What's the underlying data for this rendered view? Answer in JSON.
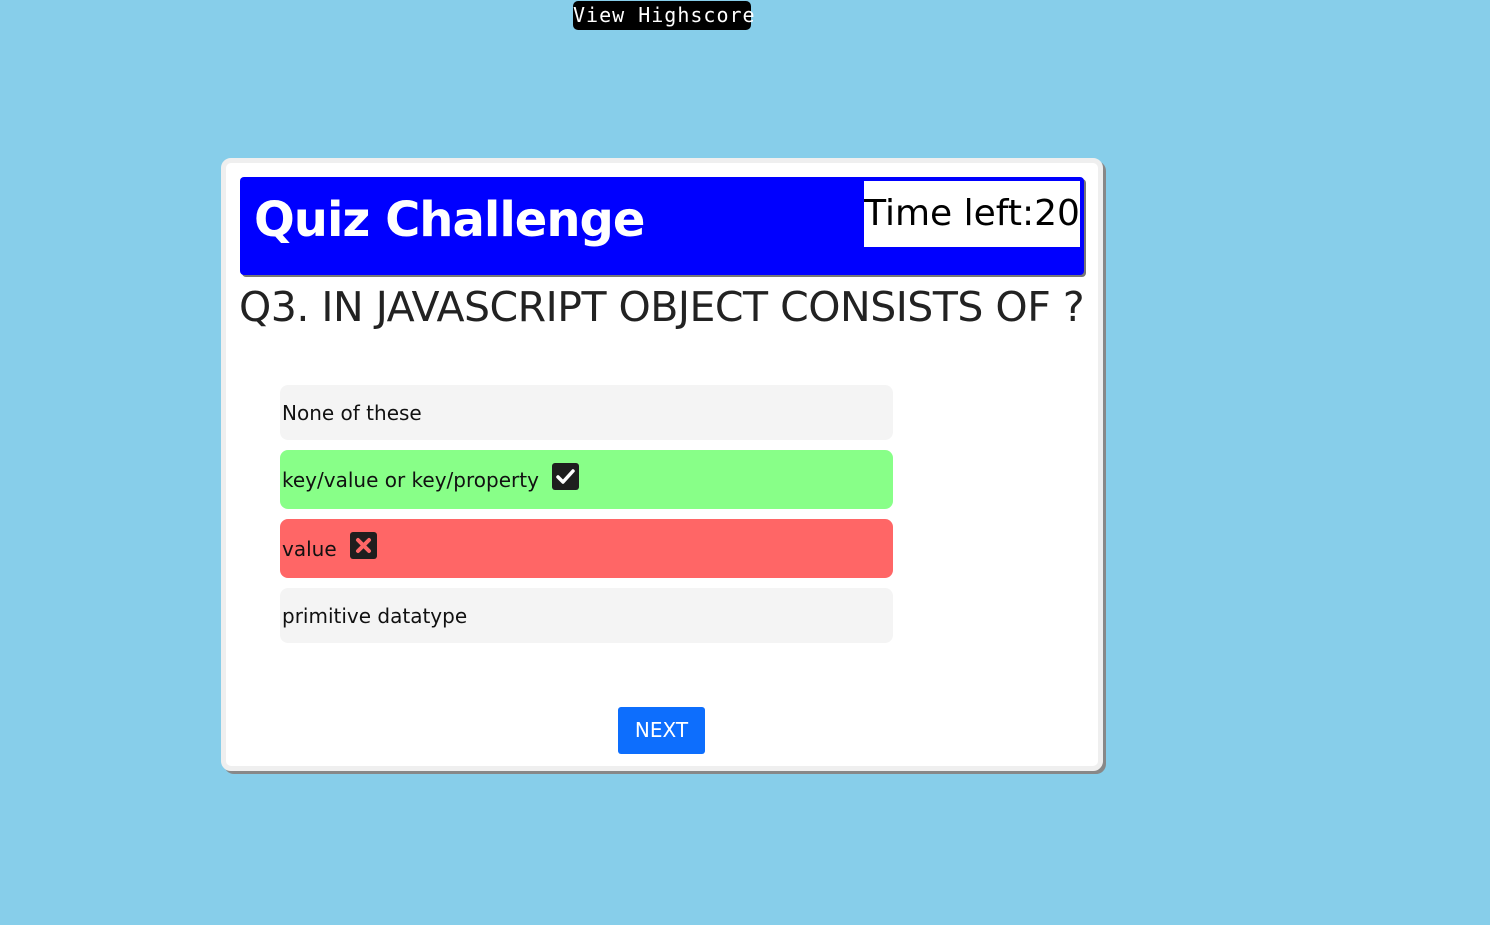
{
  "nav": {
    "highscore_label": "View Highscore"
  },
  "quiz": {
    "title": "Quiz Challenge",
    "timer_label": "Time left:20",
    "question": "Q3. IN JAVASCRIPT OBJECT CONSISTS OF ?",
    "answers": [
      {
        "label": "None of these",
        "state": "neutral"
      },
      {
        "label": "key/value or key/property",
        "state": "correct",
        "icon": "check-square-icon"
      },
      {
        "label": "value",
        "state": "wrong",
        "icon": "x-square-icon"
      },
      {
        "label": "primitive datatype",
        "state": "neutral"
      }
    ],
    "next_label": "NEXT"
  },
  "colors": {
    "background": "#87ceea",
    "header": "#0000ff",
    "correct": "#88ff88",
    "wrong": "#ff6666",
    "neutral": "#f4f4f4",
    "next_button": "#0d6efd"
  }
}
